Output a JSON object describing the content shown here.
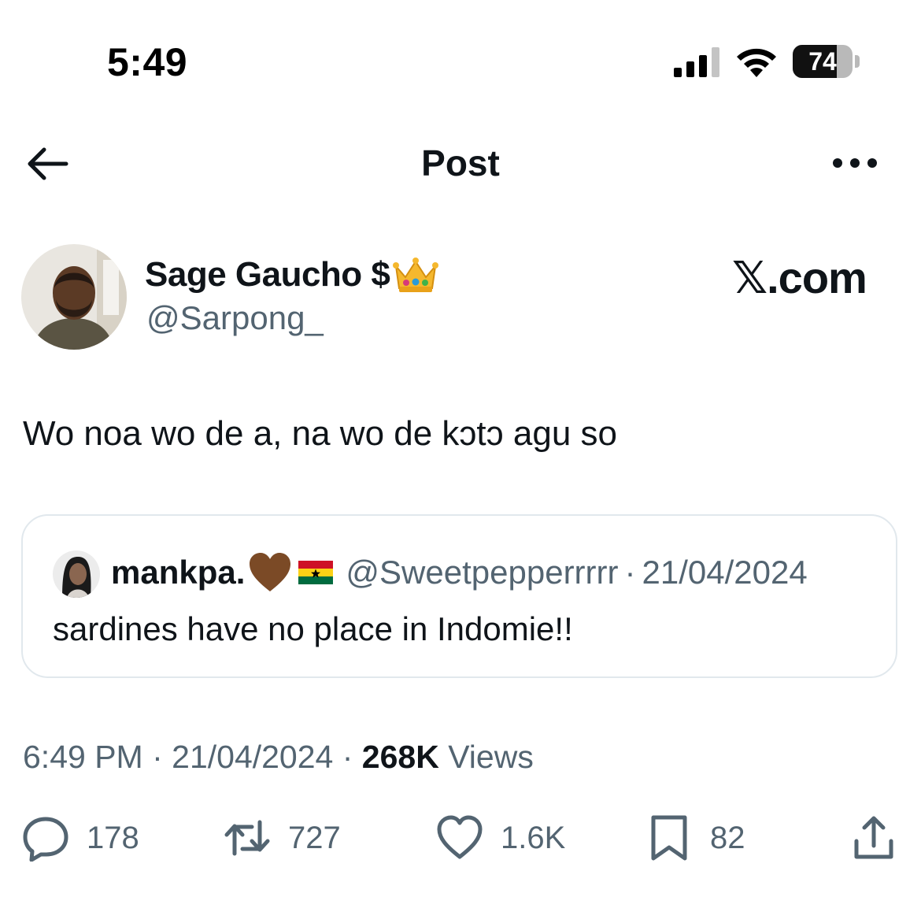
{
  "status_bar": {
    "time": "5:49",
    "battery_percent": "74",
    "battery_level": 0.74
  },
  "nav": {
    "title": "Post",
    "back_icon": "arrow-left-icon",
    "more_icon": "more-dots-icon"
  },
  "author": {
    "display_name": "Sage Gaucho $",
    "badge_emoji": "crown-emoji",
    "handle": "@Sarpong_"
  },
  "watermark": "𝕏.com",
  "post": {
    "text": "Wo noa wo de a, na wo de kɔtɔ agu so"
  },
  "quoted_post": {
    "display_name": "mankpa.",
    "emojis": [
      "brown-heart-emoji",
      "ghana-flag-emoji"
    ],
    "handle": "@Sweetpepperrrrr",
    "separator": "·",
    "date": "21/04/2024",
    "text": "sardines have no place in Indomie!!"
  },
  "meta": {
    "time": "6:49 PM",
    "separator": " · ",
    "date": "21/04/2024",
    "views_count": "268K",
    "views_label": " Views"
  },
  "actions": {
    "replies": "178",
    "reposts": "727",
    "likes": "1.6K",
    "bookmarks": "82"
  },
  "colors": {
    "text_primary": "#0f1419",
    "text_secondary": "#536471",
    "border": "#e1e8ed"
  }
}
